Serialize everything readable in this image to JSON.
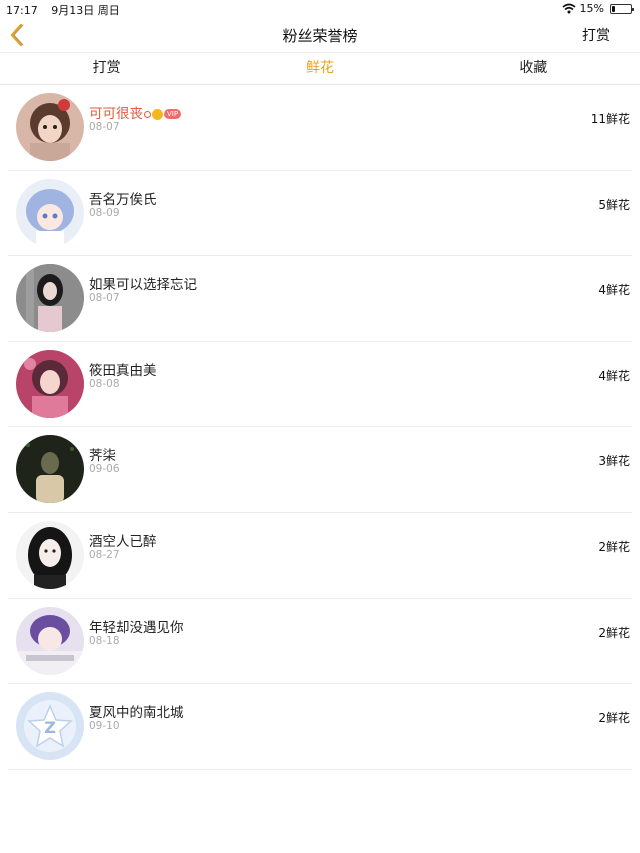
{
  "status": {
    "time": "17:17",
    "date": "9月13日 周日",
    "battery": "15%",
    "battery_level": 0.15
  },
  "nav": {
    "title": "粉丝荣誉榜",
    "right_label": "打赏"
  },
  "tabs": [
    {
      "label": "打赏",
      "active": false
    },
    {
      "label": "鲜花",
      "active": true
    },
    {
      "label": "收藏",
      "active": false
    }
  ],
  "colors": {
    "accent": "#e8a21e",
    "highlight_name": "#e05a3a",
    "vip": "#f06b6b"
  },
  "fans": [
    {
      "name": "可可很丧",
      "date": "08-07",
      "count": "11鲜花",
      "vip": true,
      "vip_label": "VIP",
      "avatar": "girl-anime-icon"
    },
    {
      "name": "吾名万俟氏",
      "date": "08-09",
      "count": "5鲜花",
      "vip": false,
      "avatar": "anime-blue-hair-icon"
    },
    {
      "name": "如果可以选择忘记",
      "date": "08-07",
      "count": "4鲜花",
      "vip": false,
      "avatar": "girl-photo-icon"
    },
    {
      "name": "筱田真由美",
      "date": "08-08",
      "count": "4鲜花",
      "vip": false,
      "avatar": "anime-pink-icon"
    },
    {
      "name": "荠柒",
      "date": "09-06",
      "count": "3鲜花",
      "vip": false,
      "avatar": "dark-figure-icon"
    },
    {
      "name": "酒空人已醉",
      "date": "08-27",
      "count": "2鲜花",
      "vip": false,
      "avatar": "girl-bw-icon"
    },
    {
      "name": "年轻却没遇见你",
      "date": "08-18",
      "count": "2鲜花",
      "vip": false,
      "avatar": "anime-purple-icon"
    },
    {
      "name": "夏风中的南北城",
      "date": "09-10",
      "count": "2鲜花",
      "vip": false,
      "avatar": "default-avatar-icon"
    }
  ]
}
